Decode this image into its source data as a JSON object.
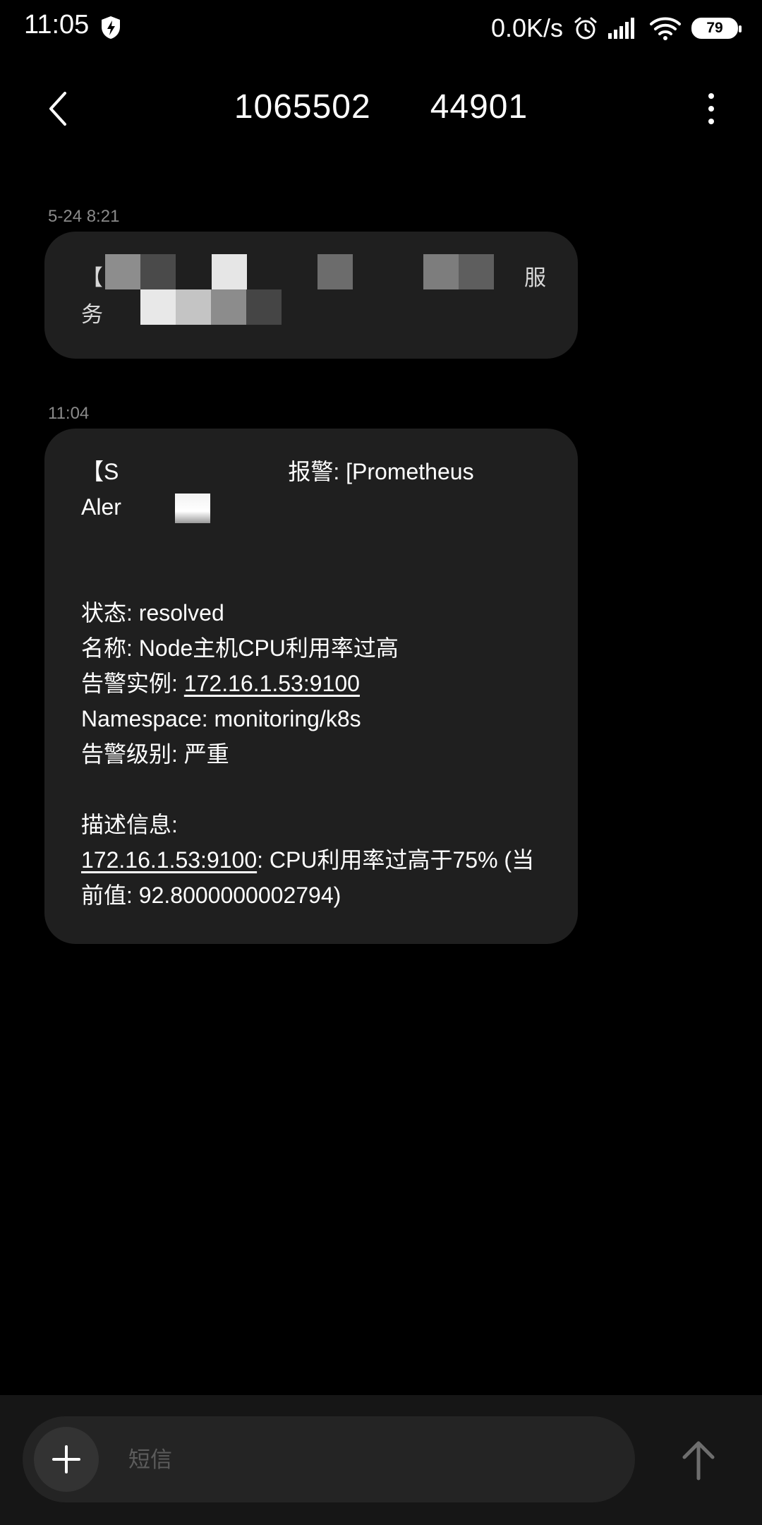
{
  "status_bar": {
    "time": "11:05",
    "net_speed": "0.0K/s",
    "battery": "79",
    "icons": [
      "shield-flash-icon",
      "alarm-clock-icon",
      "cellular-signal-icon",
      "wifi-icon",
      "battery-icon"
    ]
  },
  "header": {
    "title_start": "1065502",
    "title_end": "44901",
    "back_icon": "chevron-left-icon",
    "more_icon": "more-vertical-icon"
  },
  "messages": [
    {
      "timestamp": "5-24 8:21",
      "line1_start": "【自",
      "line1_end": "服",
      "line2_start": "务"
    },
    {
      "timestamp": "11:04",
      "line1_start": "【S",
      "line1_end": "报警: [Prometheus",
      "line2_start": "Aler",
      "status": "状态: resolved",
      "name": "名称: Node主机CPU利用率过高",
      "instance_label": "告警实例: ",
      "instance_link": "172.16.1.53:9100",
      "namespace": "Namespace: monitoring/k8s",
      "level": "告警级别: 严重",
      "desc_label": "描述信息:",
      "desc_link": "172.16.1.53:9100",
      "desc_rest": ": CPU利用率过高于75% (当",
      "desc_line2": "前值: 92.8000000002794)"
    }
  ],
  "composer": {
    "placeholder": "短信",
    "add_icon": "plus-icon",
    "send_icon": "arrow-up-icon"
  },
  "colors": {
    "background": "#000000",
    "bubble": "#1f1f1f",
    "timestamp": "#8a8a8a",
    "composer_bar": "#161616",
    "input_pill": "#242424"
  }
}
